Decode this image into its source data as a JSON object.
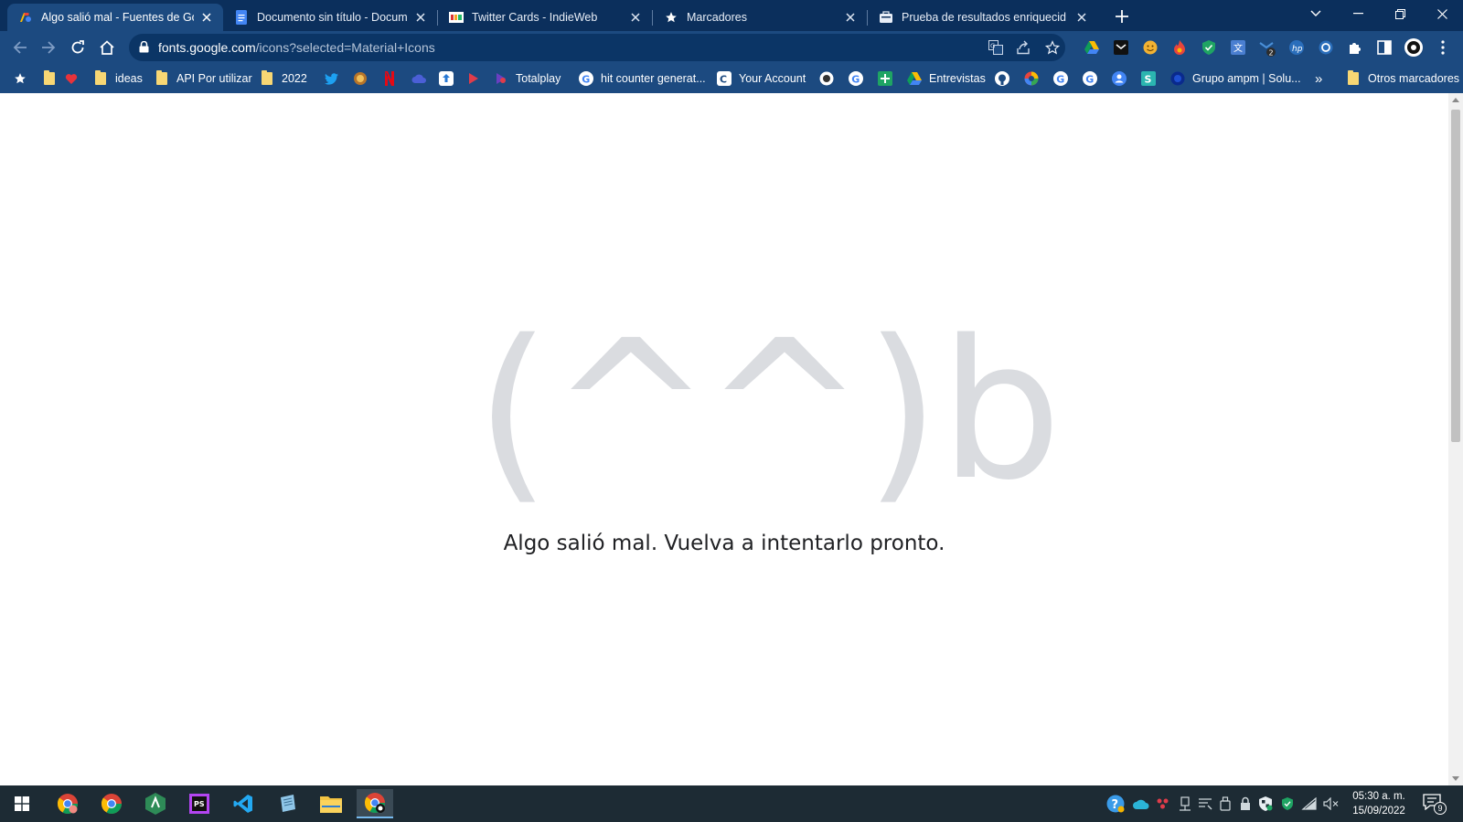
{
  "browser": {
    "tabs": [
      {
        "title": "Algo salió mal - Fuentes de Goog",
        "active": true,
        "favicon": "google-fonts-icon"
      },
      {
        "title": "Documento sin título - Documen",
        "active": false,
        "favicon": "google-docs-icon"
      },
      {
        "title": "Twitter Cards - IndieWeb",
        "active": false,
        "favicon": "indieweb-icon"
      },
      {
        "title": "Marcadores",
        "active": false,
        "favicon": "star-icon"
      },
      {
        "title": "Prueba de resultados enriquecid",
        "active": false,
        "favicon": "rich-results-icon"
      }
    ],
    "url": {
      "host": "fonts.google.com",
      "path": "/icons?selected=Material+Icons"
    },
    "bookmarks": [
      {
        "label": "",
        "icon": "star-icon"
      },
      {
        "label": "",
        "icon": "folder-icon"
      },
      {
        "label": "",
        "icon": "heart-icon"
      },
      {
        "label": "ideas",
        "icon": "folder-icon"
      },
      {
        "label": "API Por utilizar",
        "icon": "folder-icon"
      },
      {
        "label": "2022",
        "icon": "folder-icon"
      },
      {
        "label": "Totalplay",
        "icon": "totalplay-icon"
      },
      {
        "label": "hit counter generat...",
        "icon": "google-icon"
      },
      {
        "label": "Your Account",
        "icon": "account-icon"
      },
      {
        "label": "Entrevistas",
        "icon": "google-drive-icon"
      },
      {
        "label": "Grupo ampm | Solu...",
        "icon": "ampm-icon"
      },
      {
        "label": "Otros marcadores",
        "icon": "folder-icon"
      }
    ],
    "overflow_label": "»"
  },
  "page": {
    "kaomoji": {
      "left": "(^",
      "underscore": "_",
      "right": "^)b"
    },
    "error_message": "Algo salió mal. Vuelva a intentarlo pronto."
  },
  "taskbar": {
    "time": "05:30 a. m.",
    "date": "15/09/2022",
    "notification_count": "9"
  },
  "colors": {
    "tabstrip": "#0b2f5c",
    "toolbar": "#1c4a80",
    "kaomoji": "#dadce0",
    "taskbar": "#1d2b34"
  }
}
